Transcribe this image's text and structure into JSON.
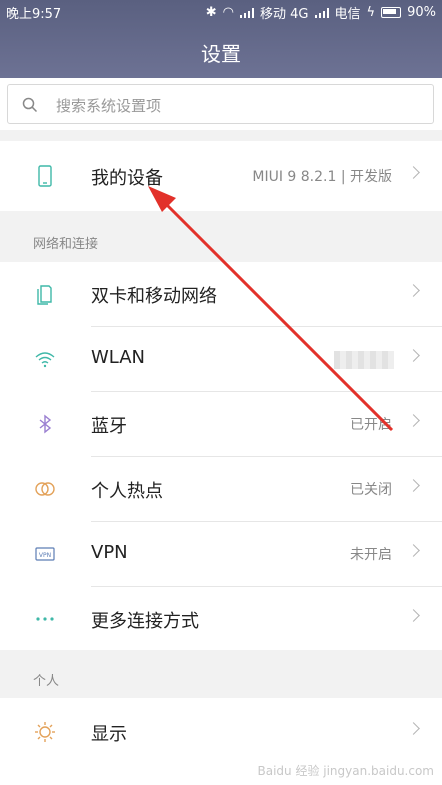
{
  "status_bar": {
    "time": "晚上9:57",
    "carrier1": "移动 4G",
    "carrier2": "电信",
    "battery": "90%"
  },
  "header": {
    "title": "设置"
  },
  "search": {
    "placeholder": "搜索系统设置项"
  },
  "device": {
    "label": "我的设备",
    "value": "MIUI 9 8.2.1 | 开发版"
  },
  "sections": {
    "network": "网络和连接",
    "personal": "个人"
  },
  "network_items": [
    {
      "label": "双卡和移动网络",
      "value": ""
    },
    {
      "label": "WLAN",
      "value": ""
    },
    {
      "label": "蓝牙",
      "value": "已开启"
    },
    {
      "label": "个人热点",
      "value": "已关闭"
    },
    {
      "label": "VPN",
      "value": "未开启"
    },
    {
      "label": "更多连接方式",
      "value": ""
    }
  ],
  "personal_items": [
    {
      "label": "显示",
      "value": ""
    }
  ],
  "watermark": "Baidu 经验 jingyan.baidu.com",
  "colors": {
    "header": "#626888",
    "accent": "#3fb8a8",
    "arrow": "#e2312a"
  }
}
